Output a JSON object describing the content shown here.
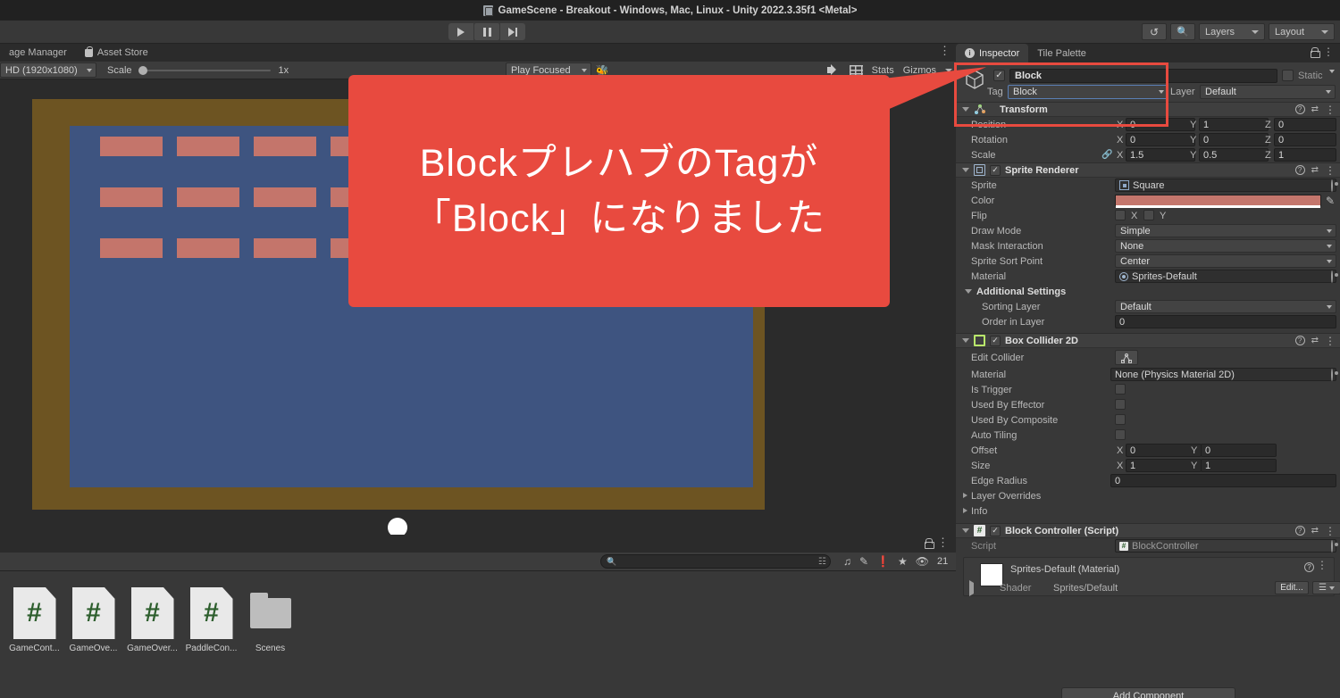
{
  "window": {
    "title": "GameScene - Breakout - Windows, Mac, Linux - Unity 2022.3.35f1 <Metal>",
    "icon": "unity-scene-icon"
  },
  "toolbar": {
    "play_icon": "play-icon",
    "pause_icon": "pause-icon",
    "step_icon": "step-icon",
    "history_icon": "history-icon",
    "search_icon": "search-icon",
    "layers_label": "Layers",
    "layout_label": "Layout"
  },
  "left_tabs": [
    {
      "label": "age Manager",
      "icon": "package-icon",
      "active": false
    },
    {
      "label": "Asset Store",
      "icon": "store-icon",
      "active": false
    }
  ],
  "game_toolbar": {
    "resolution": "HD (1920x1080)",
    "scale_label": "Scale",
    "scale_value": "1x",
    "play_mode": "Play Focused",
    "mute_icon": "speaker-icon",
    "grid_icon": "grid-icon",
    "stats_label": "Stats",
    "gizmos_label": "Gizmos",
    "bug_icon": "bug-icon"
  },
  "game_view": {
    "border_color": "#6d5422",
    "field_color": "#3e5480",
    "block_color": "#c4756b",
    "ball_color": "#ffffff",
    "paddle_color": "#ffffff",
    "block_rows": 3,
    "block_cols": 8
  },
  "callout": {
    "color": "#e84a3f",
    "line1": "BlockプレハブのTagが",
    "line2": "「Block」になりました"
  },
  "project_panel": {
    "lock_icon": "lock-icon",
    "kebab_icon": "kebab-icon",
    "search_placeholder": "",
    "search_value": "",
    "filter_icons": [
      "image-filter-icon",
      "audio-filter-icon",
      "eraser-icon",
      "warning-icon",
      "favorite-icon",
      "hidden-icon"
    ],
    "hidden_count": "21",
    "assets": [
      {
        "label": "GameCont...",
        "icon": "csharp-script-icon"
      },
      {
        "label": "GameOve...",
        "icon": "csharp-script-icon"
      },
      {
        "label": "GameOver...",
        "icon": "csharp-script-icon"
      },
      {
        "label": "PaddleCon...",
        "icon": "csharp-script-icon"
      },
      {
        "label": "Scenes",
        "icon": "folder-icon"
      }
    ]
  },
  "inspector": {
    "tabs": [
      {
        "label": "Inspector",
        "icon": "info-icon",
        "active": true
      },
      {
        "label": "Tile Palette",
        "icon": "",
        "active": false
      }
    ],
    "lock_icon": "lock-icon",
    "kebab_icon": "kebab-icon",
    "object": {
      "enabled": true,
      "name": "Block",
      "static_label": "Static",
      "tag_label": "Tag",
      "tag_value": "Block",
      "layer_label": "Layer",
      "layer_value": "Default",
      "icon": "prefab-cube-icon"
    },
    "transform": {
      "title": "Transform",
      "icon": "transform-icon",
      "rows": [
        {
          "label": "Position",
          "x": "0",
          "y": "1",
          "z": "0"
        },
        {
          "label": "Rotation",
          "x": "0",
          "y": "0",
          "z": "0"
        },
        {
          "label": "Scale",
          "x": "1.5",
          "y": "0.5",
          "z": "1"
        }
      ],
      "axis_x": "X",
      "axis_y": "Y",
      "axis_z": "Z",
      "scale_link_icon": "broken-link-icon"
    },
    "sprite_renderer": {
      "title": "Sprite Renderer",
      "icon": "sprite-renderer-icon",
      "enabled": true,
      "sprite_label": "Sprite",
      "sprite_value": "Square",
      "color_label": "Color",
      "color_value": "#c4766c",
      "eyedropper_icon": "eyedropper-icon",
      "flip_label": "Flip",
      "flip_x_label": "X",
      "flip_y_label": "Y",
      "draw_mode_label": "Draw Mode",
      "draw_mode_value": "Simple",
      "mask_interaction_label": "Mask Interaction",
      "mask_interaction_value": "None",
      "sprite_sort_point_label": "Sprite Sort Point",
      "sprite_sort_point_value": "Center",
      "material_label": "Material",
      "material_value": "Sprites-Default",
      "additional_settings_label": "Additional Settings",
      "sorting_layer_label": "Sorting Layer",
      "sorting_layer_value": "Default",
      "order_in_layer_label": "Order in Layer",
      "order_in_layer_value": "0"
    },
    "box_collider": {
      "title": "Box Collider 2D",
      "icon": "box-collider-2d-icon",
      "enabled": true,
      "edit_collider_label": "Edit Collider",
      "edit_collider_icon": "edit-collider-icon",
      "material_label": "Material",
      "material_value": "None (Physics Material 2D)",
      "is_trigger_label": "Is Trigger",
      "used_by_effector_label": "Used By Effector",
      "used_by_composite_label": "Used By Composite",
      "auto_tiling_label": "Auto Tiling",
      "offset_label": "Offset",
      "offset_x": "0",
      "offset_y": "0",
      "size_label": "Size",
      "size_x": "1",
      "size_y": "1",
      "edge_radius_label": "Edge Radius",
      "edge_radius_value": "0",
      "layer_overrides_label": "Layer Overrides",
      "info_label": "Info"
    },
    "block_controller": {
      "title": "Block Controller (Script)",
      "icon": "csharp-script-icon",
      "enabled": true,
      "script_label": "Script",
      "script_value": "BlockController"
    },
    "material_panel": {
      "title": "Sprites-Default (Material)",
      "shader_label": "Shader",
      "shader_value": "Sprites/Default",
      "edit_label": "Edit..."
    },
    "add_component_label": "Add Component"
  }
}
